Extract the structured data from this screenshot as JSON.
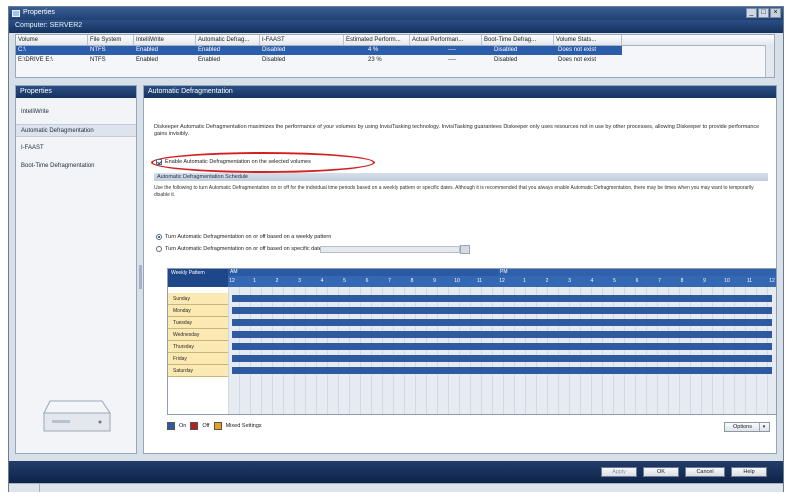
{
  "window": {
    "title": "Properties",
    "computer_label": "Computer: SERVER2"
  },
  "volume_table": {
    "headers": [
      "Volume",
      "File System",
      "IntelliWrite",
      "Automatic Defrag...",
      "I-FAAST",
      "Estimated Perform...",
      "Actual Performan...",
      "Boot-Time Defrag...",
      "Volume Stats..."
    ],
    "rows": [
      {
        "volume": "C:\\",
        "fs": "NTFS",
        "intelliwrite": "Enabled",
        "auto_defrag": "Enabled",
        "ifaast": "Disabled",
        "estimated": "4 %",
        "actual": "----",
        "boot_time": "Disabled",
        "volume_stats": "Does not exist"
      },
      {
        "volume": "E:\\DRIVE E:\\",
        "fs": "NTFS",
        "intelliwrite": "Enabled",
        "auto_defrag": "Enabled",
        "ifaast": "Disabled",
        "estimated": "23 %",
        "actual": "----",
        "boot_time": "Disabled",
        "volume_stats": "Does not exist"
      }
    ]
  },
  "left_panel": {
    "header": "Properties",
    "items": [
      "IntelliWrite",
      "Automatic Defragmentation",
      "I-FAAST",
      "Boot-Time Defragmentation"
    ]
  },
  "right_panel": {
    "header": "Automatic Defragmentation",
    "description": "Diskeeper Automatic Defragmentation maximizes the performance of your volumes by using InvisiTasking technology. InvisiTasking guarantees Diskeeper only uses resources not in use by other processes, allowing Diskeeper to provide performance gains invisibly.",
    "enable_label": "Enable Automatic Defragmentation on the selected volumes",
    "schedule_header": "Automatic Defragmentation Schedule",
    "schedule_desc": "Use the following to turn Automatic Defragmentation on or off for the individual time periods based on a weekly pattern or specific dates. Although it is recommended that you always enable Automatic Defragmentation, there may be times when you may want to temporarily disable it.",
    "radio_weekly": "Turn Automatic Defragmentation on or off based on a weekly pattern",
    "radio_dates": "Turn Automatic Defragmentation on or off based on specific dates"
  },
  "schedule_grid": {
    "corner_label": "Weekly Pattern",
    "am_label": "AM",
    "pm_label": "PM",
    "hours": [
      "12",
      "1",
      "2",
      "3",
      "4",
      "5",
      "6",
      "7",
      "8",
      "9",
      "10",
      "11",
      "12",
      "1",
      "2",
      "3",
      "4",
      "5",
      "6",
      "7",
      "8",
      "9",
      "10",
      "11",
      "12"
    ],
    "days": [
      "Sunday",
      "Monday",
      "Tuesday",
      "Wednesday",
      "Thursday",
      "Friday",
      "Saturday"
    ],
    "state": "on-all-day"
  },
  "legend": {
    "on": "On",
    "off": "Off",
    "mixed": "Mixed Settings",
    "options": "Options",
    "colors": {
      "on": "#2d5aa0",
      "off": "#b22222",
      "mixed": "#e8a020"
    }
  },
  "footer": {
    "apply": "Apply",
    "ok": "OK",
    "cancel": "Cancel",
    "help": "Help"
  }
}
